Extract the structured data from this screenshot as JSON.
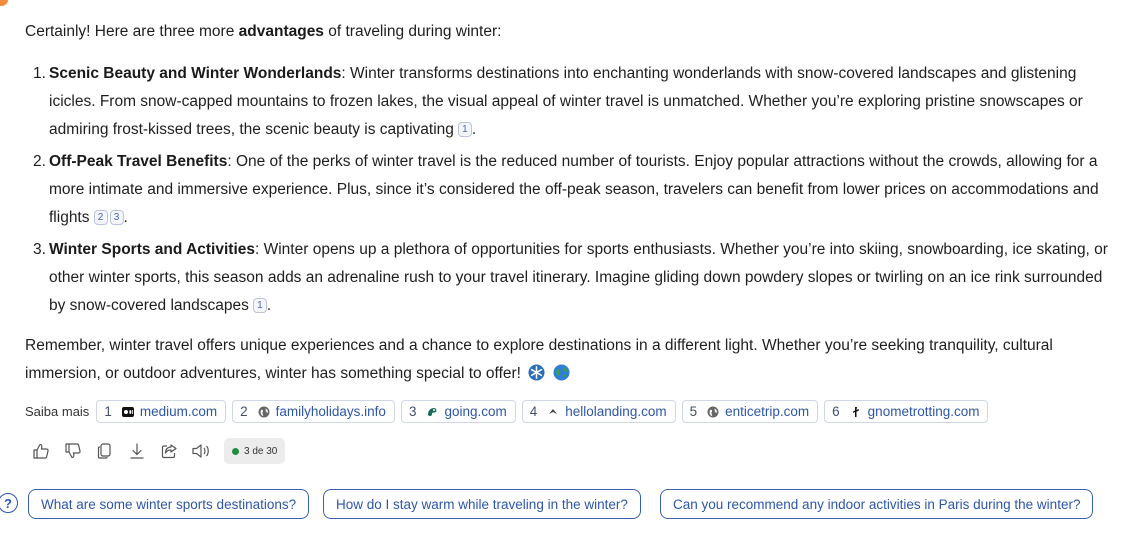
{
  "message": {
    "intro_before": "Certainly! Here are three more ",
    "intro_bold": "advantages",
    "intro_after": " of traveling during winter:",
    "points": [
      {
        "num": "1.",
        "title": "Scenic Beauty and Winter Wonderlands",
        "text": ": Winter transforms destinations into enchanting wonderlands with snow-covered landscapes and glistening icicles. From snow-capped mountains to frozen lakes, the visual appeal of winter travel is unmatched. Whether you’re exploring pristine snowscapes or admiring frost-kissed trees, the scenic beauty is captivating",
        "cites": [
          "1"
        ],
        "end": "."
      },
      {
        "num": "2.",
        "title": "Off-Peak Travel Benefits",
        "text": ": One of the perks of winter travel is the reduced number of tourists. Enjoy popular attractions without the crowds, allowing for a more intimate and immersive experience. Plus, since it’s considered the off-peak season, travelers can benefit from lower prices on accommodations and flights",
        "cites": [
          "2",
          "3"
        ],
        "end": "."
      },
      {
        "num": "3.",
        "title": "Winter Sports and Activities",
        "text": ": Winter opens up a plethora of opportunities for sports enthusiasts. Whether you’re into skiing, snowboarding, ice skating, or other winter sports, this season adds an adrenaline rush to your travel itinerary. Imagine gliding down powdery slopes or twirling on an ice rink surrounded by snow-covered landscapes",
        "cites": [
          "1"
        ],
        "end": "."
      }
    ],
    "outro": "Remember, winter travel offers unique experiences and a chance to explore destinations in a different light. Whether you’re seeking tranquility, cultural immersion, or outdoor adventures, winter has something special to offer!",
    "emojis": [
      "snowflake-icon",
      "globe-icon"
    ]
  },
  "learn_more": {
    "label": "Saiba mais",
    "sources": [
      {
        "num": "1",
        "domain": "medium.com",
        "icon": "medium-icon"
      },
      {
        "num": "2",
        "domain": "familyholidays.info",
        "icon": "globe-icon"
      },
      {
        "num": "3",
        "domain": "going.com",
        "icon": "going-icon"
      },
      {
        "num": "4",
        "domain": "hellolanding.com",
        "icon": "hellolanding-icon"
      },
      {
        "num": "5",
        "domain": "enticetrip.com",
        "icon": "globe-icon"
      },
      {
        "num": "6",
        "domain": "gnometrotting.com",
        "icon": "gnometrotting-icon"
      }
    ]
  },
  "actions": {
    "icons": [
      "thumbs-up-icon",
      "thumbs-down-icon",
      "copy-icon",
      "download-icon",
      "share-icon",
      "speaker-icon"
    ],
    "turn_count": "3 de 30",
    "status_color": "#1e8e3e"
  },
  "suggestions": [
    "What are some winter sports destinations?",
    "How do I stay warm while traveling in the winter?",
    "Can you recommend any indoor activities in Paris during the winter?"
  ],
  "colors": {
    "accent": "#2d56ad",
    "text": "#1e1e1e",
    "avatar": "#f28b3b"
  }
}
